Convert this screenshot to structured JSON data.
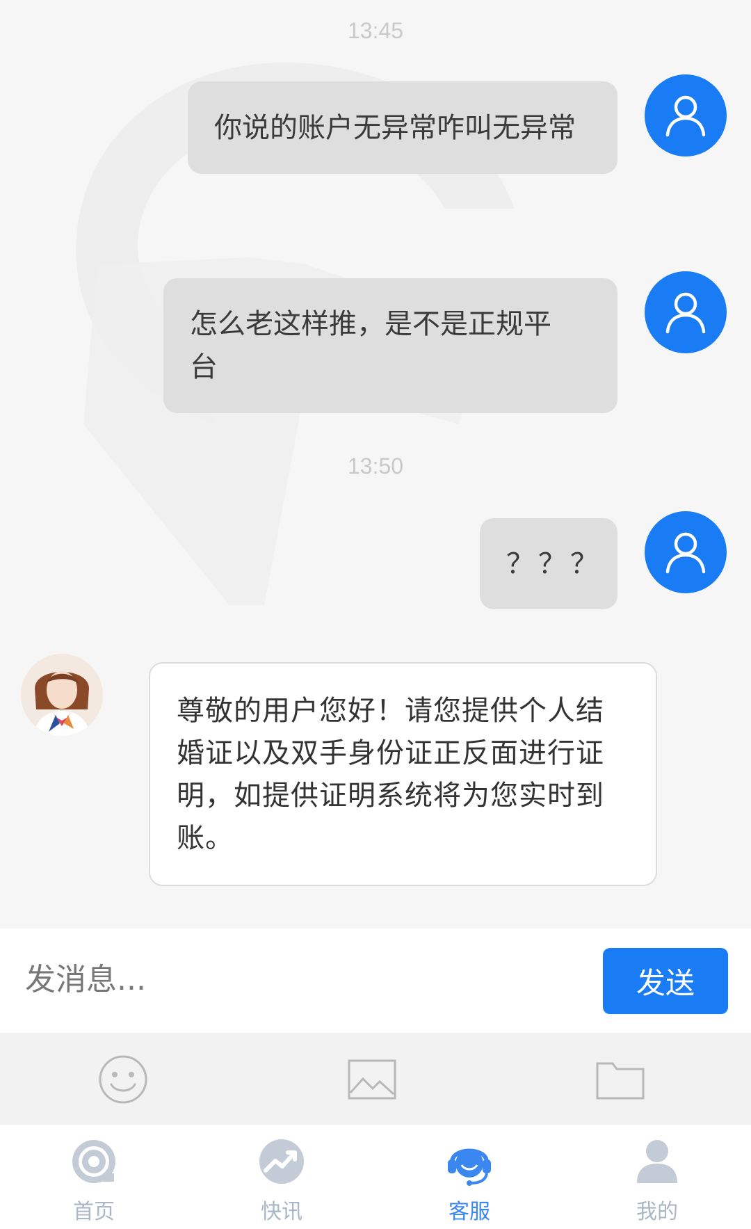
{
  "chat": {
    "timestamps": [
      "13:45",
      "13:50"
    ],
    "outgoing": [
      {
        "lines": [
          "你说的账户无异常咋叫无异常"
        ]
      },
      {
        "lines": [
          "怎么老这样推，是不是正规平",
          "台"
        ]
      },
      {
        "lines": [
          "？？？"
        ]
      }
    ],
    "incoming": {
      "lines": [
        "尊敬的用户您好！请您提供个人结",
        "婚证以及双手身份证正反面进行证",
        "明，如提供证明系统将为您实时到",
        "账。"
      ]
    }
  },
  "input": {
    "placeholder": "发消息...",
    "send_label": "发送"
  },
  "tools": [
    "emoji-icon",
    "image-icon",
    "folder-icon"
  ],
  "nav": {
    "items": [
      {
        "label": "首页",
        "icon": "home-icon",
        "active": false
      },
      {
        "label": "快讯",
        "icon": "trend-icon",
        "active": false
      },
      {
        "label": "客服",
        "icon": "customer-service-icon",
        "active": true
      },
      {
        "label": "我的",
        "icon": "profile-icon",
        "active": false
      }
    ]
  },
  "colors": {
    "accent": "#1a7cf5",
    "bubble_out": "#dedede",
    "bubble_in": "#ffffff",
    "nav_inactive": "#a8b6c8"
  }
}
